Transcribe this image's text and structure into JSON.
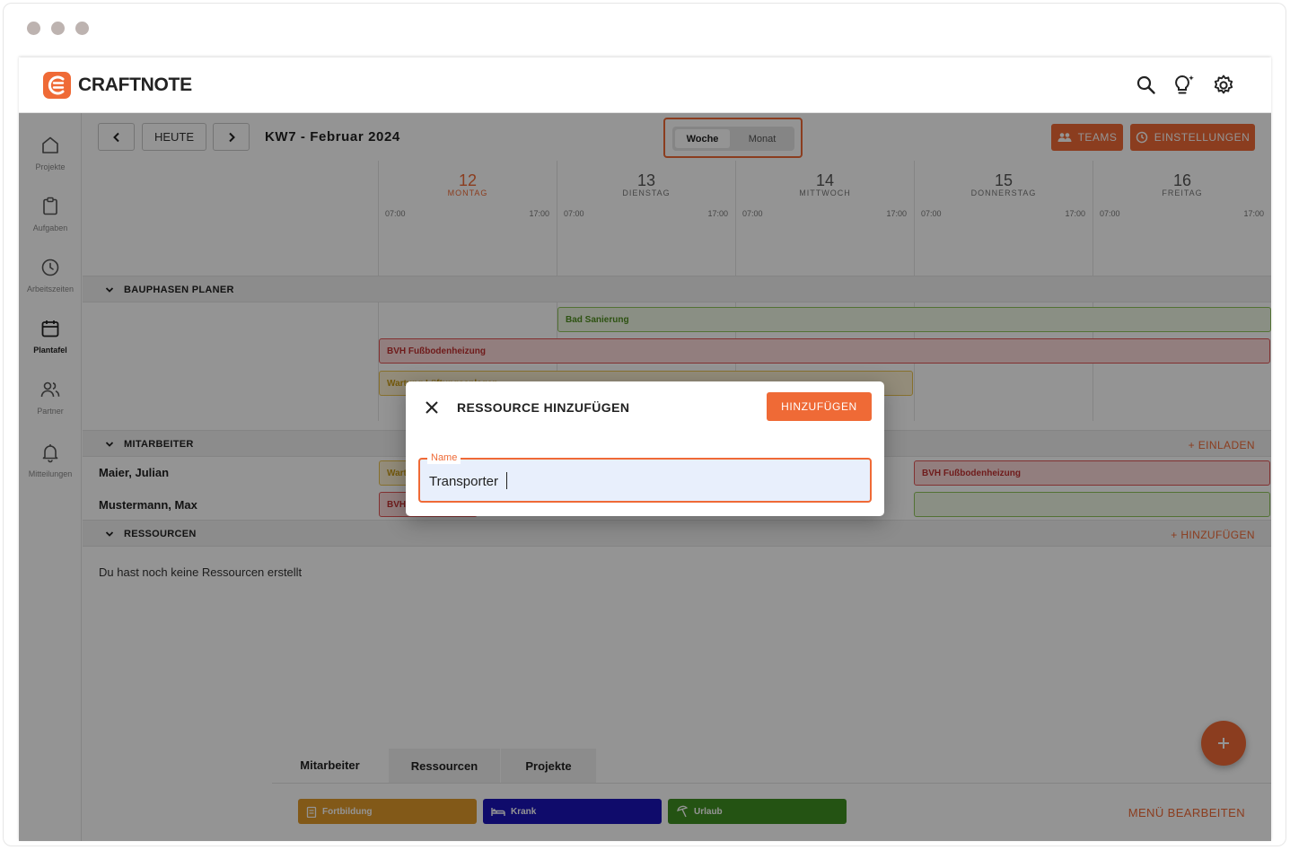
{
  "app": {
    "name": "CRAFTNOTE"
  },
  "sidebar": {
    "items": [
      {
        "label": "Projekte",
        "icon": "home-icon"
      },
      {
        "label": "Aufgaben",
        "icon": "clipboard-icon"
      },
      {
        "label": "Arbeitszeiten",
        "icon": "clock-icon"
      },
      {
        "label": "Plantafel",
        "icon": "calendar-icon",
        "active": true
      },
      {
        "label": "Partner",
        "icon": "users-icon"
      },
      {
        "label": "Mitteilungen",
        "icon": "bell-icon"
      }
    ]
  },
  "toolbar": {
    "today_label": "HEUTE",
    "week_title": "KW7 - Februar 2024",
    "view_week": "Woche",
    "view_month": "Monat",
    "teams_label": "TEAMS",
    "settings_label": "EINSTELLUNGEN"
  },
  "days": [
    {
      "num": "12",
      "name": "MONTAG",
      "start": "07:00",
      "end": "17:00",
      "highlight": true
    },
    {
      "num": "13",
      "name": "DIENSTAG",
      "start": "07:00",
      "end": "17:00"
    },
    {
      "num": "14",
      "name": "MITTWOCH",
      "start": "07:00",
      "end": "17:00"
    },
    {
      "num": "15",
      "name": "DONNERSTAG",
      "start": "07:00",
      "end": "17:00"
    },
    {
      "num": "16",
      "name": "FREITAG",
      "start": "07:00",
      "end": "17:00"
    }
  ],
  "sections": {
    "phases": {
      "label": "BAUPHASEN PLANER"
    },
    "staff": {
      "label": "MITARBEITER",
      "action": "+ EINLADEN"
    },
    "resources": {
      "label": "RESSOURCEN",
      "action": "+ HINZUFÜGEN",
      "empty": "Du hast noch keine Ressourcen erstellt"
    }
  },
  "phase_bars": [
    {
      "label": "Bad Sanierung"
    },
    {
      "label": "BVH Fußbodenheizung"
    },
    {
      "label": "Wartung Lüftungsanlagen"
    }
  ],
  "staff_rows": [
    {
      "name": "Maier, Julian",
      "bar_left": "Wart",
      "bar_right": "BVH Fußbodenheizung"
    },
    {
      "name": "Mustermann, Max",
      "bar_left": "BVH"
    }
  ],
  "bottom": {
    "tabs": [
      "Mitarbeiter",
      "Ressourcen",
      "Projekte"
    ],
    "legend": [
      {
        "label": "Fortbildung",
        "color": "#e09a2a"
      },
      {
        "label": "Krank",
        "color": "#1a14b8"
      },
      {
        "label": "Urlaub",
        "color": "#3e8f22"
      }
    ],
    "menu_edit": "MENÜ BEARBEITEN"
  },
  "modal": {
    "title": "RESSOURCE HINZUFÜGEN",
    "submit_label": "HINZUFÜGEN",
    "field_label": "Name",
    "field_value": "Transporter"
  },
  "colors": {
    "accent": "#ef6a36"
  }
}
